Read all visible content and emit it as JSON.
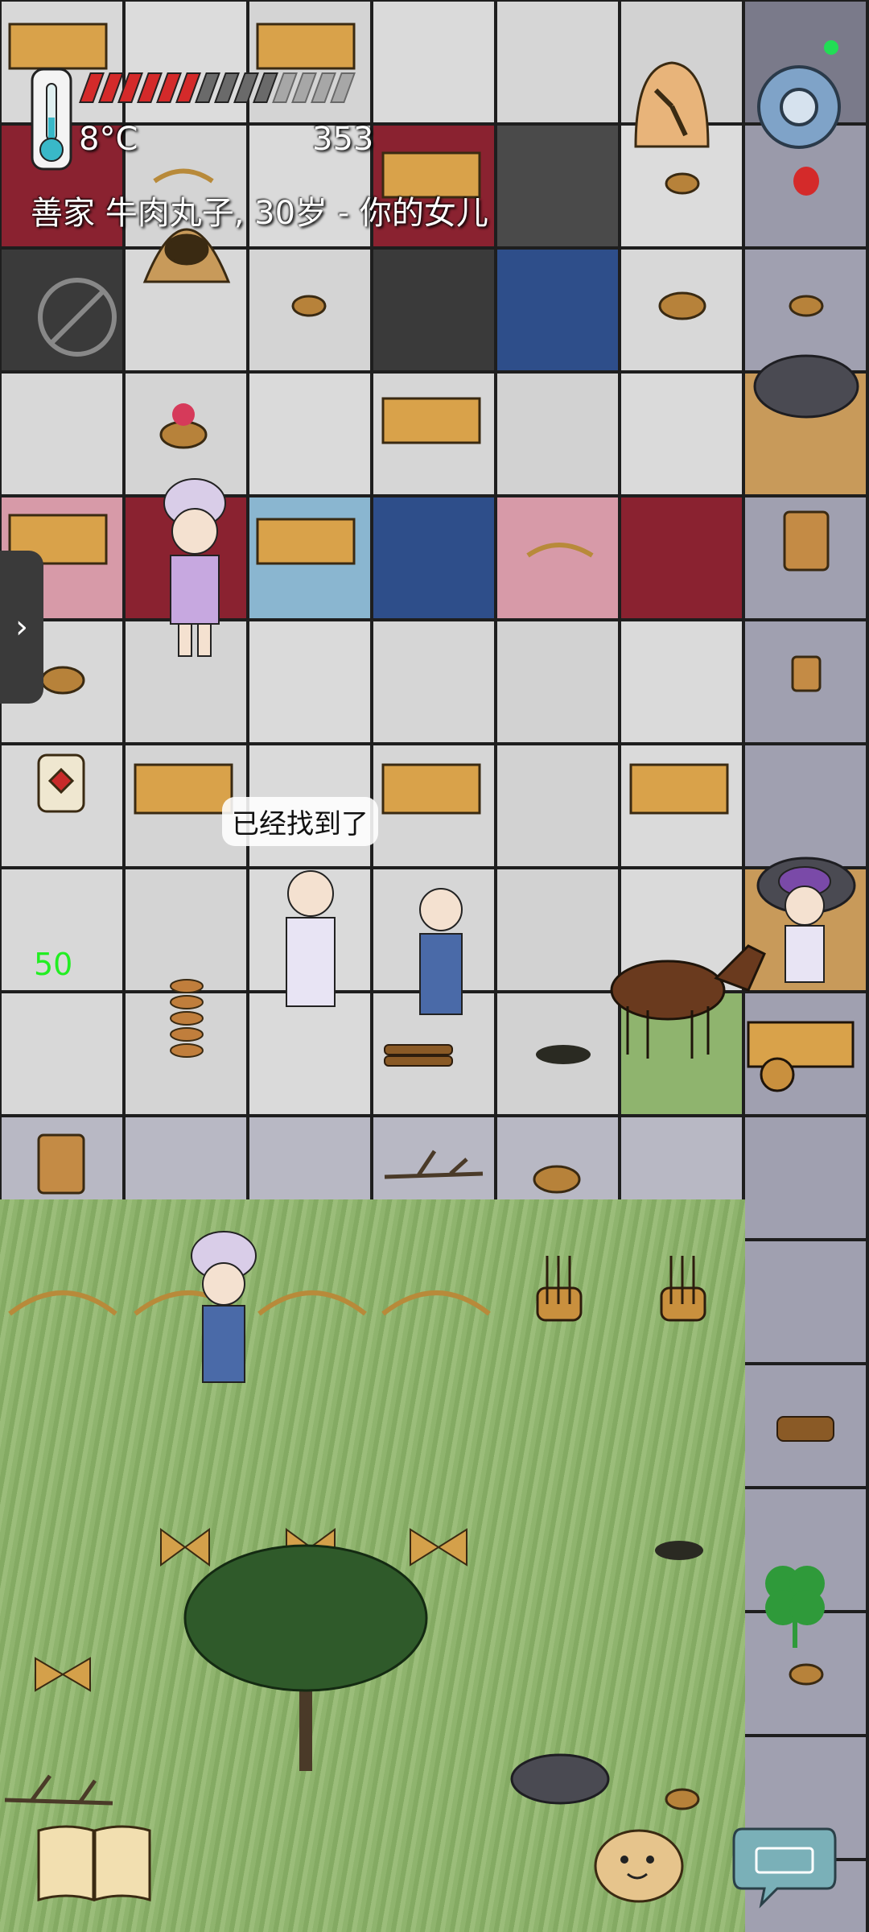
{
  "hud": {
    "temperature": "8°C",
    "food_value": "353",
    "player_info": "善家 牛肉丸子, 30岁 - 你的女儿",
    "hunger_full_pips": 6,
    "hunger_total_pips": 14
  },
  "world": {
    "speech_bubble": "已经找到了",
    "coordinate_readout": "50"
  },
  "icons": {
    "thermometer": "thermometer-icon",
    "compass": "compass-icon",
    "settings": "gear-icon",
    "no_insects": "no-bugs-icon",
    "side_panel": "chevron-right-icon",
    "recipe_book": "book-icon",
    "emote": "potato-face-icon",
    "chat": "keyboard-icon",
    "lucky": "clover-icon"
  },
  "colors": {
    "hunger_full": "#d42a2a",
    "status_dot": "#22dd55",
    "coordinate_text": "#22ee22"
  }
}
